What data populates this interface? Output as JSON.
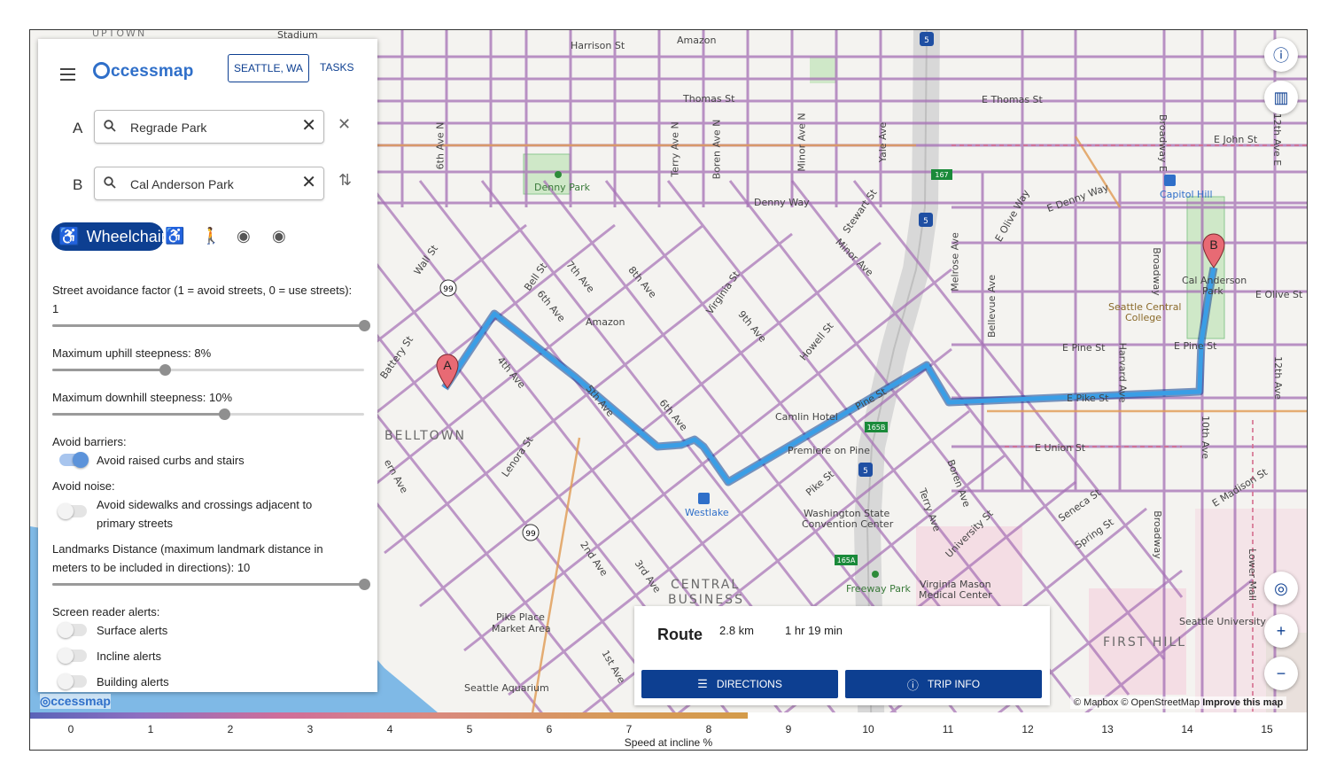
{
  "app": {
    "logo_text": "ccessmap",
    "region_button": "SEATTLE, WA",
    "tasks_button": "TASKS",
    "mini_logo_text": "ccessmap"
  },
  "waypoints": {
    "a_label": "A",
    "a_value": "Regrade Park",
    "b_label": "B",
    "b_value": "Cal Anderson Park"
  },
  "modes": {
    "active_label": "Wheelchair"
  },
  "settings": {
    "street_avoidance": "Street avoidance factor (1 = avoid streets, 0 = use streets): 1",
    "street_avoidance_value": 1,
    "uphill": "Maximum uphill steepness: 8%",
    "uphill_value": 0.36,
    "downhill": "Maximum downhill steepness: 10%",
    "downhill_value": 0.55,
    "avoid_barriers_heading": "Avoid barriers:",
    "avoid_barriers_toggle": "Avoid raised curbs and stairs",
    "avoid_barriers_on": true,
    "avoid_noise_heading": "Avoid noise:",
    "avoid_noise_toggle": "Avoid sidewalks and crossings adjacent to primary streets",
    "avoid_noise_on": false,
    "landmarks": "Landmarks Distance (maximum landmark distance in meters to be included in directions): 10",
    "landmarks_value": 1,
    "screen_reader_heading": "Screen reader alerts:",
    "surface_alerts": "Surface alerts",
    "incline_alerts": "Incline alerts",
    "building_alerts": "Building alerts"
  },
  "route": {
    "title": "Route",
    "distance": "2.8 km",
    "duration": "1 hr 19 min",
    "directions_button": "DIRECTIONS",
    "trip_info_button": "TRIP INFO"
  },
  "map": {
    "attribution_mapbox": "© Mapbox",
    "attribution_osm": "© OpenStreetMap",
    "attribution_improve": "Improve this map",
    "marker_a": "A",
    "marker_b": "B",
    "districts": {
      "belltown": "BELLTOWN",
      "central_business": "CENTRAL",
      "central_business_2": "BUSINESS",
      "first_hill": "FIRST HILL",
      "uptown": "UPTOWN"
    },
    "labels": {
      "harrison": "Harrison St",
      "thomas": "Thomas St",
      "e_thomas": "E Thomas St",
      "e_john": "E John St",
      "denny_park": "Denny Park",
      "denny_way": "Denny Way",
      "e_denny_way": "E Denny Way",
      "capitol_hill": "Capitol Hill",
      "cal_anderson": "Cal Anderson",
      "cal_anderson_2": "Park",
      "seattle_central": "Seattle Central",
      "seattle_central_2": "College",
      "e_pine": "E Pine St",
      "e_pike": "E Pike St",
      "e_olive": "E Olive St",
      "e_union": "E Union St",
      "e_madison": "E Madison St",
      "amazon": "Amazon",
      "amazon_top": "Amazon",
      "camlin": "Camlin Hotel",
      "premiere": "Premiere on Pine",
      "westlake": "Westlake",
      "wscc": "Washington State",
      "wscc_2": "Convention Center",
      "freeway_park": "Freeway Park",
      "virginia_mason": "Virginia Mason",
      "virginia_mason_2": "Medical Center",
      "pike_place": "Pike Place",
      "pike_place_2": "Market Area",
      "aquarium": "Seattle Aquarium",
      "seattle_university": "Seattle University",
      "seneca": "Seneca St",
      "spring": "Spring St",
      "university": "University St",
      "pine_st": "Pine St",
      "pike_st": "Pike St",
      "howell": "Howell St",
      "stewart": "Stewart St",
      "minor": "Minor Ave",
      "virginia": "Virginia St",
      "ninth": "9th Ave",
      "eighth": "8th Ave",
      "seventh": "7th Ave",
      "sixth": "6th Ave",
      "sixth_b": "6th Ave",
      "fifth": "5th Ave",
      "fourth": "4th Ave",
      "third": "3rd Ave",
      "second": "2nd Ave",
      "first": "1st Ave",
      "lenora": "Lenora St",
      "battery": "Battery St",
      "wall": "Wall St",
      "bell": "Bell St",
      "sixth_n": "6th Ave N",
      "terry_n": "Terry Ave N",
      "boren_n": "Boren Ave N",
      "minor_n": "Minor Ave N",
      "yale": "Yale Ave",
      "melrose": "Melrose Ave",
      "bellevue": "Bellevue Ave",
      "olive_way": "E Olive Way",
      "broadway_e": "Broadway E",
      "broadway": "Broadway",
      "broadway_s": "Broadway",
      "harvard": "Harvard Ave",
      "tenth": "10th Ave",
      "twelfth": "12th Ave",
      "twelfth_e": "12th Ave E",
      "boren": "Boren Ave",
      "terry": "Terry Ave",
      "lower_mall": "Lower Mall",
      "elliott": "ern Ave",
      "stadium": "Stadium"
    },
    "shields": {
      "i5": "5",
      "sr99": "99",
      "exit_167": "167",
      "exit_165b": "165B",
      "exit_165a": "165A"
    }
  },
  "legend": {
    "ticks": [
      "0",
      "1",
      "2",
      "3",
      "4",
      "5",
      "6",
      "7",
      "8",
      "9",
      "10",
      "11",
      "12",
      "13",
      "14",
      "15"
    ],
    "caption": "Speed at incline %"
  },
  "colors": {
    "primary": "#0d3f91",
    "route": "#3a9ee6",
    "logo": "#2f6fc9"
  }
}
